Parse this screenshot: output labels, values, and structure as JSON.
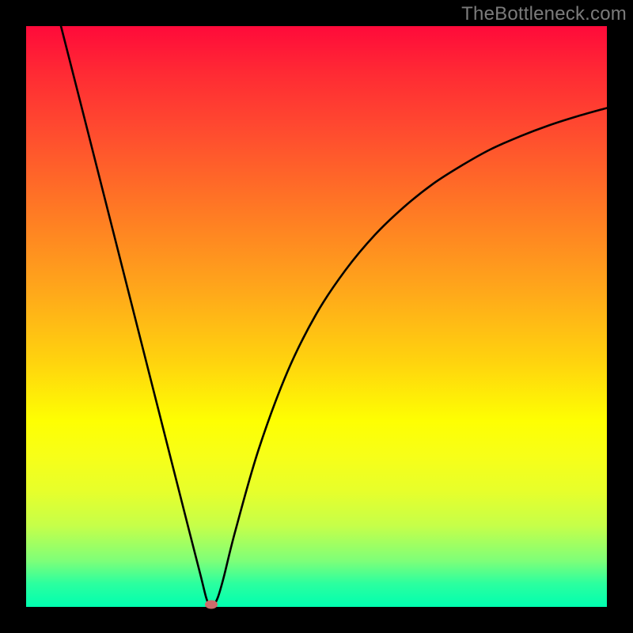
{
  "watermark": "TheBottleneck.com",
  "chart_data": {
    "type": "line",
    "title": "",
    "xlabel": "",
    "ylabel": "",
    "xlim": [
      0,
      100
    ],
    "ylim": [
      0,
      100
    ],
    "series": [
      {
        "name": "curve",
        "x": [
          6.0,
          10,
          15,
          20,
          25,
          28,
          30,
          31,
          31.6,
          32.2,
          33,
          34,
          36,
          40,
          45,
          50,
          55,
          60,
          65,
          70,
          75,
          80,
          85,
          90,
          95,
          100
        ],
        "values": [
          100,
          84.3,
          64.6,
          44.9,
          25.2,
          13.4,
          5.6,
          1.6,
          0.2,
          0.2,
          1.6,
          5.0,
          13.0,
          27.0,
          40.5,
          50.5,
          58.0,
          64.0,
          68.8,
          72.8,
          76.0,
          78.8,
          81.0,
          82.9,
          84.5,
          85.9
        ]
      }
    ],
    "marker": {
      "x": 31.9,
      "y": 0.4,
      "color": "#cc6b6b"
    },
    "background_gradient": {
      "top": "#ff0a3a",
      "mid_upper": "#ffa91a",
      "mid_lower": "#feff02",
      "bottom": "#00ffb0"
    }
  }
}
